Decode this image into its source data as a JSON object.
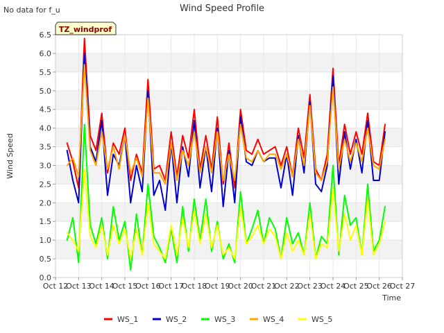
{
  "nodata_text": "No data for f_u",
  "site_badge": "TZ_windprof",
  "chart_data": {
    "type": "line",
    "title": "Wind Speed Profile",
    "xlabel": "Time",
    "ylabel": "Wind Speed",
    "ylim": [
      0.0,
      6.5
    ],
    "y_ticks": [
      "0.0",
      "0.5",
      "1.0",
      "1.5",
      "2.0",
      "2.5",
      "3.0",
      "3.5",
      "4.0",
      "4.5",
      "5.0",
      "5.5",
      "6.0",
      "6.5"
    ],
    "xlim": [
      12,
      27
    ],
    "x_unit": "day of October",
    "x_ticks": [
      "Oct 12",
      "Oct 13",
      "Oct 14",
      "Oct 15",
      "Oct 16",
      "Oct 17",
      "Oct 18",
      "Oct 19",
      "Oct 20",
      "Oct 21",
      "Oct 22",
      "Oct 23",
      "Oct 24",
      "Oct 25",
      "Oct 26",
      "Oct 27"
    ],
    "grid": true,
    "banded_background": true,
    "legend_position": "bottom",
    "x": [
      12.5,
      12.75,
      13.0,
      13.25,
      13.5,
      13.75,
      14.0,
      14.25,
      14.5,
      14.75,
      15.0,
      15.25,
      15.5,
      15.75,
      16.0,
      16.25,
      16.5,
      16.75,
      17.0,
      17.25,
      17.5,
      17.75,
      18.0,
      18.25,
      18.5,
      18.75,
      19.0,
      19.25,
      19.5,
      19.75,
      20.0,
      20.25,
      20.5,
      20.75,
      21.0,
      21.25,
      21.5,
      21.75,
      22.0,
      22.25,
      22.5,
      22.75,
      23.0,
      23.25,
      23.5,
      23.75,
      24.0,
      24.25,
      24.5,
      24.75,
      25.0,
      25.25,
      25.5,
      25.75,
      26.0,
      26.25
    ],
    "series": [
      {
        "name": "WS_1",
        "color": "#ff0000",
        "values": [
          3.6,
          3.1,
          2.4,
          6.4,
          3.8,
          3.4,
          4.4,
          2.8,
          3.6,
          3.3,
          4.0,
          2.6,
          3.3,
          2.8,
          5.3,
          2.9,
          3.0,
          2.6,
          3.9,
          2.7,
          3.8,
          3.2,
          4.5,
          2.9,
          3.8,
          2.9,
          4.3,
          2.5,
          3.6,
          2.4,
          4.5,
          3.4,
          3.3,
          3.7,
          3.3,
          3.4,
          3.5,
          3.0,
          3.5,
          2.7,
          4.0,
          3.2,
          4.9,
          2.9,
          2.6,
          3.3,
          5.6,
          3.0,
          4.1,
          3.3,
          3.9,
          3.3,
          4.4,
          3.1,
          3.0,
          4.1
        ]
      },
      {
        "name": "WS_2",
        "color": "#0000cc",
        "values": [
          3.4,
          2.6,
          2.0,
          6.0,
          3.5,
          3.1,
          4.2,
          2.2,
          3.3,
          3.0,
          3.8,
          2.0,
          3.0,
          2.3,
          5.0,
          2.2,
          2.6,
          1.8,
          3.6,
          2.0,
          3.5,
          2.7,
          4.2,
          2.4,
          3.5,
          2.3,
          4.0,
          1.9,
          3.4,
          2.0,
          4.3,
          3.1,
          3.0,
          3.4,
          3.1,
          3.2,
          3.2,
          2.4,
          3.3,
          2.2,
          3.8,
          2.8,
          4.7,
          2.5,
          2.3,
          3.0,
          5.4,
          2.5,
          3.9,
          2.9,
          3.7,
          2.8,
          4.2,
          2.6,
          2.6,
          3.9
        ]
      },
      {
        "name": "WS_3",
        "color": "#00ff00",
        "values": [
          1.0,
          1.6,
          0.4,
          4.1,
          1.4,
          0.9,
          1.6,
          0.5,
          1.9,
          1.0,
          1.5,
          0.2,
          1.7,
          0.6,
          2.5,
          1.1,
          0.8,
          0.4,
          1.3,
          0.4,
          1.9,
          0.7,
          2.1,
          1.0,
          2.1,
          0.7,
          1.5,
          0.5,
          0.9,
          0.4,
          2.3,
          0.9,
          1.3,
          1.8,
          0.9,
          1.6,
          1.3,
          0.5,
          1.6,
          0.9,
          1.2,
          0.6,
          2.0,
          0.5,
          1.1,
          0.9,
          3.0,
          0.6,
          2.2,
          1.4,
          1.6,
          0.6,
          2.5,
          0.7,
          1.0,
          1.9
        ]
      },
      {
        "name": "WS_4",
        "color": "#ffa500",
        "values": [
          3.0,
          3.2,
          2.7,
          5.7,
          3.4,
          3.0,
          3.9,
          2.9,
          3.5,
          2.9,
          3.8,
          2.8,
          3.2,
          2.7,
          4.8,
          2.8,
          2.8,
          2.5,
          3.6,
          2.6,
          3.4,
          3.0,
          3.9,
          2.8,
          3.5,
          2.8,
          3.9,
          2.6,
          3.3,
          2.6,
          4.1,
          3.2,
          3.1,
          3.4,
          3.1,
          3.3,
          3.3,
          2.9,
          3.3,
          2.7,
          3.7,
          3.0,
          4.6,
          2.8,
          2.6,
          3.1,
          5.1,
          2.9,
          3.7,
          3.1,
          3.6,
          3.1,
          4.0,
          3.0,
          2.9,
          3.7
        ]
      },
      {
        "name": "WS_5",
        "color": "#ffff00",
        "values": [
          1.2,
          1.0,
          0.7,
          2.9,
          1.1,
          0.8,
          1.4,
          0.6,
          1.4,
          0.9,
          1.3,
          0.5,
          1.3,
          0.6,
          2.0,
          0.9,
          0.7,
          0.5,
          1.4,
          0.6,
          1.6,
          0.8,
          1.8,
          0.9,
          1.7,
          0.8,
          1.4,
          0.6,
          0.8,
          0.5,
          1.9,
          0.9,
          1.1,
          1.4,
          0.9,
          1.3,
          1.1,
          0.5,
          1.2,
          0.7,
          1.0,
          0.6,
          1.7,
          0.5,
          0.9,
          0.8,
          2.4,
          0.7,
          1.7,
          1.0,
          1.4,
          0.6,
          2.1,
          0.6,
          0.9,
          1.5
        ]
      }
    ]
  }
}
